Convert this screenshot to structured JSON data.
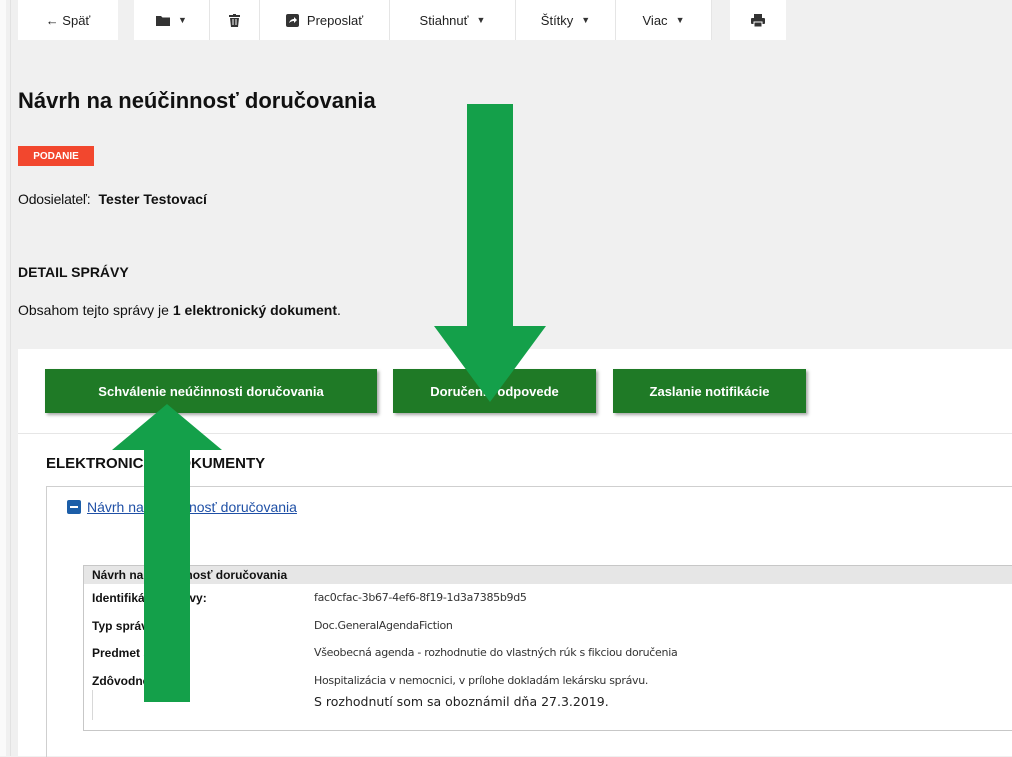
{
  "toolbar": {
    "back": "← Späť",
    "forward": "Preposlať",
    "download": "Stiahnuť",
    "tags": "Štítky",
    "more": "Viac",
    "icons": [
      "folder-icon",
      "trash-icon",
      "forward-icon",
      "print-icon"
    ]
  },
  "message": {
    "title": "Návrh na neúčinnosť doručovania",
    "badge": "PODANIE",
    "sender_label": "Odosielateľ:",
    "sender_name": "Tester Testovací"
  },
  "detail": {
    "title": "DETAIL SPRÁVY",
    "text_prefix": "Obsahom tejto správy je ",
    "text_bold": "1 elektronický dokument",
    "text_suffix": "."
  },
  "actions": {
    "approve": "Schválenie neúčinnosti doručovania",
    "deliver": "Doručenie odpovede",
    "notify": "Zaslanie notifikácie"
  },
  "documents": {
    "title": "ELEKTRONICKÉ DOKUMENTY",
    "link": "Návrh na neúčinnosť doručovania",
    "table_title": "Návrh na neúčinnosť doručovania",
    "rows": [
      {
        "label": "Identifikátor správy:",
        "value": "fac0cfac-3b67-4ef6-8f19-1d3a7385b9d5"
      },
      {
        "label": "Typ správy:",
        "value": "Doc.GeneralAgendaFiction"
      },
      {
        "label": "Predmet správy:",
        "value": "Všeobecná agenda - rozhodnutie do vlastných rúk s fikciou doručenia"
      },
      {
        "label": "Zdôvodnenie:",
        "value": "Hospitalizácia v nemocnici, v prílohe dokladám lekársku správu."
      }
    ],
    "note": "S rozhodnutí som sa oboznámil dňa 27.3.2019."
  },
  "colors": {
    "accent_green": "#1f7a26",
    "arrow_green": "#14a04a",
    "badge_red": "#f2472e",
    "link_blue": "#1f50a6"
  }
}
